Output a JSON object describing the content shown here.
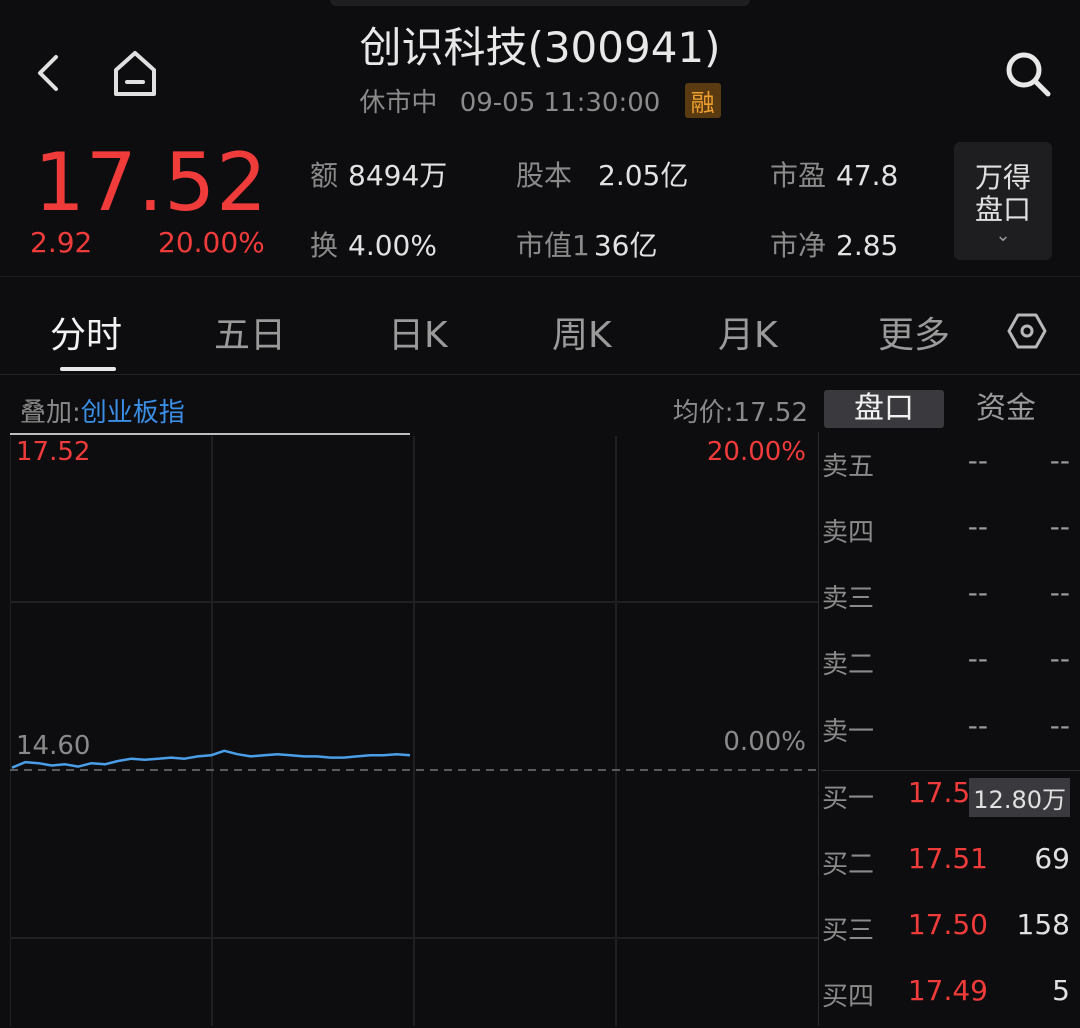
{
  "header": {
    "title": "创识科技(300941)",
    "status": "休市中",
    "datetime": "09-05 11:30:00",
    "margin_badge": "融"
  },
  "quote": {
    "price": "17.52",
    "change": "2.92",
    "change_pct": "20.00%",
    "stats": [
      {
        "label": "额",
        "value": "8494万"
      },
      {
        "label": "股本",
        "value": "2.05亿"
      },
      {
        "label": "市盈",
        "value": "47.8"
      },
      {
        "label": "换",
        "value": "4.00%"
      },
      {
        "label": "市值1",
        "value": "36亿"
      },
      {
        "label": "市净",
        "value": "2.85"
      }
    ],
    "wind_button": {
      "line1": "万得",
      "line2": "盘口",
      "chevron": "⌄"
    }
  },
  "tabs": [
    "分时",
    "五日",
    "日K",
    "周K",
    "月K",
    "更多"
  ],
  "active_tab": "分时",
  "chart_header": {
    "overlay_label": "叠加:",
    "overlay_index": "创业板指",
    "avg_price": "均价:17.52",
    "panel_tabs": [
      "盘口",
      "资金"
    ]
  },
  "chart_data": {
    "type": "line",
    "y_top_label": "17.52",
    "y_top_pct": "20.00%",
    "y_base_label": "14.60",
    "y_base_pct": "0.00%",
    "ylim": [
      14.6,
      17.52
    ],
    "x": [
      0,
      4,
      8,
      12,
      16,
      20,
      24,
      28,
      32,
      36,
      40,
      44,
      48,
      52,
      56,
      60,
      64,
      68,
      72,
      76,
      80,
      84,
      88,
      92,
      96,
      100,
      104,
      108,
      112,
      116,
      120
    ],
    "series": [
      {
        "values": [
          14.62,
          14.67,
          14.66,
          14.64,
          14.65,
          14.63,
          14.66,
          14.65,
          14.68,
          14.7,
          14.69,
          14.7,
          14.71,
          14.7,
          14.72,
          14.73,
          14.77,
          14.74,
          14.72,
          14.73,
          14.74,
          14.73,
          14.72,
          14.72,
          14.71,
          14.71,
          14.72,
          14.73,
          14.73,
          14.74,
          14.73
        ]
      }
    ]
  },
  "order_book": {
    "sells": [
      {
        "label": "卖五",
        "price": "--",
        "vol": "--"
      },
      {
        "label": "卖四",
        "price": "--",
        "vol": "--"
      },
      {
        "label": "卖三",
        "price": "--",
        "vol": "--"
      },
      {
        "label": "卖二",
        "price": "--",
        "vol": "--"
      },
      {
        "label": "卖一",
        "price": "--",
        "vol": "--"
      }
    ],
    "buys": [
      {
        "label": "买一",
        "price": "17.52",
        "vol": "12.80万"
      },
      {
        "label": "买二",
        "price": "17.51",
        "vol": "69"
      },
      {
        "label": "买三",
        "price": "17.50",
        "vol": "158"
      },
      {
        "label": "买四",
        "price": "17.49",
        "vol": "5"
      }
    ]
  },
  "colors": {
    "up": "#f03b3b",
    "accent": "#3a8ee6",
    "line": "#4a9ee8",
    "badge": "#f0a030"
  }
}
